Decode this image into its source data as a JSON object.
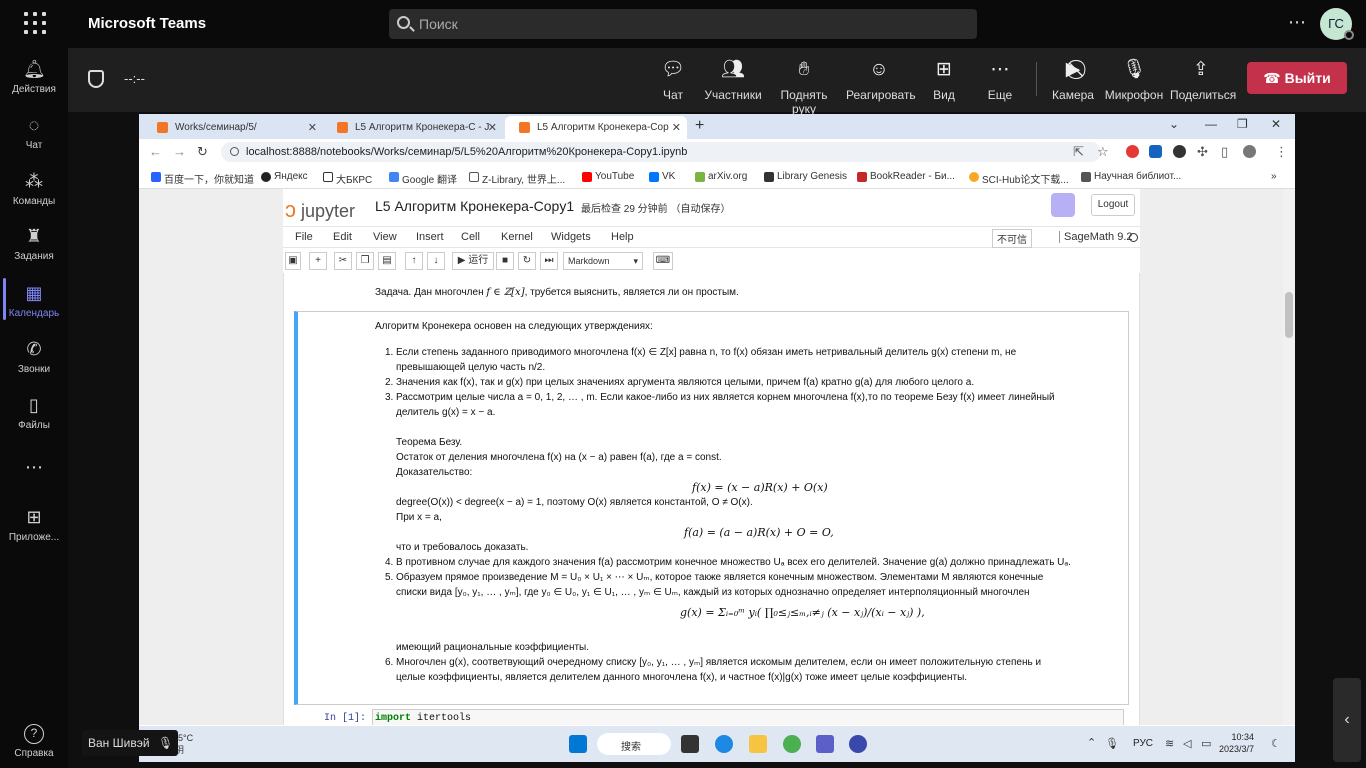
{
  "teams": {
    "app_title": "Microsoft Teams",
    "search_placeholder": "Поиск",
    "avatar_initials": "ГС",
    "rail": [
      {
        "label": "Действия",
        "icon": "bell-icon"
      },
      {
        "label": "Чат",
        "icon": "chat-icon"
      },
      {
        "label": "Команды",
        "icon": "teams-icon"
      },
      {
        "label": "Задания",
        "icon": "assignments-icon"
      },
      {
        "label": "Календарь",
        "icon": "calendar-icon",
        "active": true
      },
      {
        "label": "Звонки",
        "icon": "phone-icon"
      },
      {
        "label": "Файлы",
        "icon": "file-icon"
      },
      {
        "label": "Приложе...",
        "icon": "apps-icon"
      }
    ],
    "help_label": "Справка",
    "timer": "--:--",
    "meeting_buttons": [
      {
        "label": "Чат",
        "icon": "chat-icon"
      },
      {
        "label": "Участники",
        "icon": "people-icon"
      },
      {
        "label": "Поднять руку",
        "icon": "hand-icon"
      },
      {
        "label": "Реагировать",
        "icon": "smile-icon"
      },
      {
        "label": "Вид",
        "icon": "grid-icon"
      },
      {
        "label": "Еще",
        "icon": "more-icon"
      },
      {
        "label": "Камера",
        "icon": "camera-off-icon"
      },
      {
        "label": "Микрофон",
        "icon": "mic-off-icon"
      },
      {
        "label": "Поделиться",
        "icon": "share-icon"
      }
    ],
    "leave_label": "Выйти",
    "presenter_name": "Ван Шивэй",
    "accent": "#7f85f5",
    "leave_color": "#c4314b"
  },
  "browser": {
    "tabs": [
      {
        "title": "Works/семинар/5/",
        "active": false
      },
      {
        "title": "L5 Алгоритм Кронекера-С - J",
        "active": false
      },
      {
        "title": "L5 Алгоритм Кронекера-Сор",
        "active": true
      }
    ],
    "url": "localhost:8888/notebooks/Works/семинар/5/L5%20Алгоритм%20Кронекера-Copy1.ipynb",
    "bookmarks": [
      "百度一下，你就知道",
      "Яндекс",
      "大БКРС",
      "Google 翻译",
      "Z-Library, 世界上...",
      "YouTube",
      "VK",
      "arXiv.org",
      "Library Genesis",
      "BookReader - Би...",
      "SCI-Hub论文下载...",
      "Научная библиот..."
    ]
  },
  "jupyter": {
    "logo_text": "jupyter",
    "notebook_title": "L5 Алгоритм Кронекера-Copy1",
    "save_status": "最后检查 29 分钟前 （自动保存）",
    "logout": "Logout",
    "menus": [
      "File",
      "Edit",
      "View",
      "Insert",
      "Cell",
      "Kernel",
      "Widgets",
      "Help"
    ],
    "trusted": "不可信",
    "kernel": "SageMath 9.2",
    "run_label": "运行",
    "cell_type": "Markdown"
  },
  "notebook": {
    "task_a": "Задача. Дан многочлен ",
    "task_f": "f ∈ ℤ[x]",
    "task_b": ", трубется выяснить, является ли он простым.",
    "intro": "Алгоритм Кронекера основен на следующих утверждениях:",
    "i1a": "Если степень заданного приводимого многочлена f(x) ∈ Z[x] равна n, то f(x) обязан иметь нетривальный делитель g(x) степени m, не",
    "i1b": "превышающей целую часть n/2.",
    "i2": "Значения как f(x), так и g(x) при целых значениях аргумента являются целыми, причем f(a) кратно g(a) для любого целого a.",
    "i3a": "Рассмотрим целые числа a = 0, 1, 2, … , m. Если какое-либо из них является корнем многочлена f(x),то по теореме Безу f(x) имеет линейный",
    "i3b": "делитель g(x) = x − a.",
    "bezout": "Теорема Безу.",
    "rem": "Остаток от деления многочлена f(x) на (x − a) равен f(a), где a = const.",
    "proof": "Доказательство:",
    "f1": "f(x) = (x − a)R(x) + O(x)",
    "deg": "degree(O(x)) < degree(x − a) = 1, поэтому O(x) является константой, O ≠ O(x).",
    "atx": "При x = a,",
    "f2": "f(a) = (a − a)R(x) + O = O,",
    "qed": "что и требовалось доказать.",
    "i4": "В противном случае для каждого значения f(a) рассмотрим конечное множество Uₐ всех его делителей. Значение g(a) должно принадлежать Uₐ.",
    "i5a": "Образуем прямое произведение M = U₀ × U₁ × ⋯ × Uₘ, которое также является конечным множеством. Элементами M являются конечные",
    "i5b": "списки вида [y₀, y₁, … , yₘ], где y₀ ∈ U₀, y₁ ∈ U₁, … , yₘ ∈ Uₘ, каждый из которых однозначно определяет интерполяционный многочлен",
    "f3": "g(x) = Σᵢ₌₀ᵐ yᵢ( ∏₀≤ⱼ≤ₘ,ᵢ≠ⱼ (x − xⱼ)/(xᵢ − xⱼ) ),",
    "rat": "имеющий рациональные коэффициенты.",
    "i6a": "Многочлен g(x), соответвующий очередному списку [y₀, y₁, … , yₘ] является искомым делителем, если он имеет положительную степень и",
    "i6b": "целые коэффициенты, является делителем данного многочлена f(x), и частное f(x)|g(x) тоже имеет целые коэффициенты.",
    "prompt": "In [1]:",
    "code_kw": "import",
    "code_mod": " itertools"
  },
  "taskbar": {
    "weather": "-5°C",
    "weather_sub": "阴",
    "search": "搜索",
    "lang": "РУС",
    "time": "10:34",
    "date": "2023/3/7"
  }
}
